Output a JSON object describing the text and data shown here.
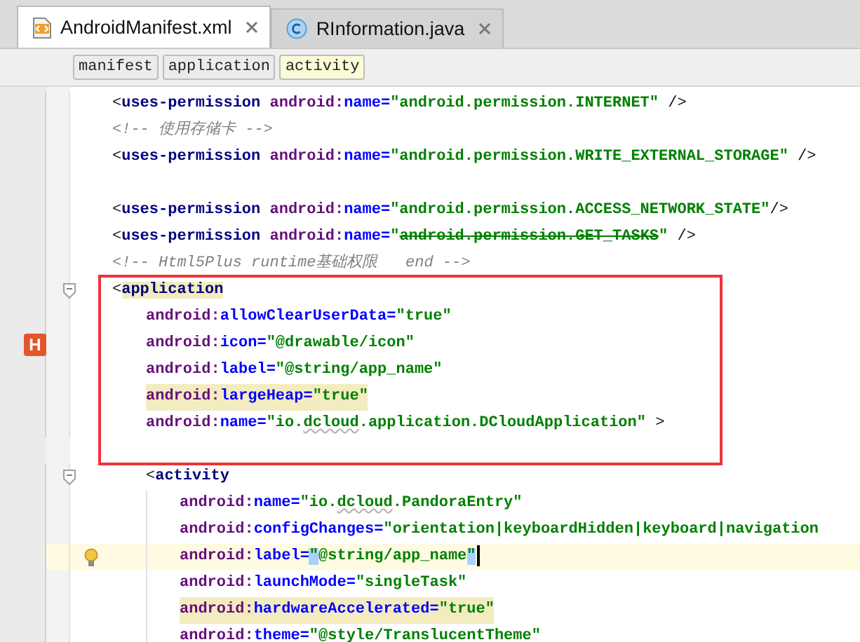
{
  "tabs": [
    {
      "label": "AndroidManifest.xml",
      "selected": true,
      "kind": "xml"
    },
    {
      "label": "RInformation.java",
      "selected": false,
      "kind": "class"
    }
  ],
  "breadcrumbs": [
    {
      "label": "manifest",
      "selected": false
    },
    {
      "label": "application",
      "selected": false
    },
    {
      "label": "activity",
      "selected": true
    }
  ],
  "lines": [
    {
      "kind": "code",
      "tokens": [
        {
          "kind": "punct",
          "text": "<"
        },
        {
          "kind": "tag",
          "text": "uses-permission"
        },
        {
          "kind": "ns",
          "text": " android:"
        },
        {
          "kind": "attr",
          "text": "name="
        },
        {
          "kind": "value",
          "text": "\"android.permission.INTERNET\""
        },
        {
          "kind": "punct",
          "text": " />"
        }
      ]
    },
    {
      "kind": "code",
      "tokens": [
        {
          "kind": "comment",
          "text": "<!-- 使用存储卡 -->"
        }
      ]
    },
    {
      "kind": "code",
      "tokens": [
        {
          "kind": "punct",
          "text": "<"
        },
        {
          "kind": "tag",
          "text": "uses-permission"
        },
        {
          "kind": "ns",
          "text": " android:"
        },
        {
          "kind": "attr",
          "text": "name="
        },
        {
          "kind": "value",
          "text": "\"android.permission.WRITE_EXTERNAL_STORAGE\""
        },
        {
          "kind": "punct",
          "text": " />"
        }
      ]
    },
    {
      "kind": "blank"
    },
    {
      "kind": "code",
      "tokens": [
        {
          "kind": "punct",
          "text": "<"
        },
        {
          "kind": "tag",
          "text": "uses-permission"
        },
        {
          "kind": "ns",
          "text": " android:"
        },
        {
          "kind": "attr",
          "text": "name="
        },
        {
          "kind": "value",
          "text": "\"android.permission.ACCESS_NETWORK_STATE\""
        },
        {
          "kind": "punct",
          "text": "/>"
        }
      ]
    },
    {
      "kind": "code",
      "tokens": [
        {
          "kind": "punct",
          "text": "<"
        },
        {
          "kind": "tag",
          "text": "uses-permission"
        },
        {
          "kind": "ns",
          "text": " android:"
        },
        {
          "kind": "attr",
          "text": "name="
        },
        {
          "kind": "value",
          "text": "\""
        },
        {
          "kind": "struck",
          "text": "android.permission.GET_TASKS"
        },
        {
          "kind": "value",
          "text": "\""
        },
        {
          "kind": "punct",
          "text": " />"
        }
      ]
    },
    {
      "kind": "code",
      "tokens": [
        {
          "kind": "comment",
          "text": "<!-- Html5Plus runtime基础权限   end -->"
        }
      ]
    },
    {
      "kind": "code",
      "gutter": {
        "kind": "fold"
      },
      "framed": true,
      "tokens": [
        {
          "kind": "punct",
          "text": "<"
        },
        {
          "kind": "tag-matched",
          "text": "application"
        }
      ],
      "attributes": [
        {
          "kind": "code",
          "tokens": [
            {
              "kind": "ns",
              "text": "android:"
            },
            {
              "kind": "attr",
              "text": "allowClearUserData="
            },
            {
              "kind": "value",
              "text": "\"true\""
            }
          ]
        },
        {
          "kind": "code",
          "gutter": {
            "kind": "bookmark",
            "label": "H"
          },
          "tokens": [
            {
              "kind": "ns",
              "text": "android:"
            },
            {
              "kind": "attr",
              "text": "icon="
            },
            {
              "kind": "value",
              "text": "\"@drawable/icon\""
            }
          ]
        },
        {
          "kind": "code",
          "tokens": [
            {
              "kind": "ns",
              "text": "android:"
            },
            {
              "kind": "attr",
              "text": "label="
            },
            {
              "kind": "value",
              "text": "\"@string/app_name\""
            }
          ]
        },
        {
          "kind": "matched",
          "tokens": [
            {
              "kind": "ns",
              "text": "android:"
            },
            {
              "kind": "attr",
              "text": "largeHeap="
            },
            {
              "kind": "value",
              "text": "\"true\""
            }
          ]
        },
        {
          "kind": "code",
          "tokens": [
            {
              "kind": "ns",
              "text": "android:"
            },
            {
              "kind": "attr",
              "text": "name="
            },
            {
              "kind": "value",
              "text": "\"io."
            },
            {
              "kind": "typo",
              "text": "dcloud"
            },
            {
              "kind": "value",
              "text": ".application.DCloudApplication\""
            },
            {
              "kind": "punct",
              "text": " >"
            }
          ]
        }
      ],
      "children": [
        {
          "kind": "code",
          "gutter": {
            "kind": "fold"
          },
          "tokens": [
            {
              "kind": "punct",
              "text": "<"
            },
            {
              "kind": "tag",
              "text": "activity"
            }
          ],
          "attributes": [
            {
              "kind": "code",
              "tokens": [
                {
                  "kind": "ns",
                  "text": "android:"
                },
                {
                  "kind": "attr",
                  "text": "name="
                },
                {
                  "kind": "value",
                  "text": "\"io."
                },
                {
                  "kind": "typo",
                  "text": "dcloud"
                },
                {
                  "kind": "value",
                  "text": ".PandoraEntry\""
                }
              ]
            },
            {
              "kind": "code",
              "tokens": [
                {
                  "kind": "ns",
                  "text": "android:"
                },
                {
                  "kind": "attr",
                  "text": "configChanges="
                },
                {
                  "kind": "value",
                  "text": "\"orientation|keyboardHidden|keyboard|navigation"
                }
              ]
            },
            {
              "kind": "current",
              "gutter": {
                "kind": "bulb"
              },
              "tokens": [
                {
                  "kind": "ns",
                  "text": "android:"
                },
                {
                  "kind": "attr",
                  "text": "label="
                },
                {
                  "kind": "selected",
                  "text": "\""
                },
                {
                  "kind": "value",
                  "text": "@string/app_name"
                },
                {
                  "kind": "selected",
                  "text": "\""
                }
              ]
            },
            {
              "kind": "code",
              "tokens": [
                {
                  "kind": "ns",
                  "text": "android:"
                },
                {
                  "kind": "attr",
                  "text": "launchMode="
                },
                {
                  "kind": "value",
                  "text": "\"singleTask\""
                }
              ]
            },
            {
              "kind": "matched",
              "tokens": [
                {
                  "kind": "ns",
                  "text": "android:"
                },
                {
                  "kind": "attr",
                  "text": "hardwareAccelerated="
                },
                {
                  "kind": "value",
                  "text": "\"true\""
                }
              ]
            },
            {
              "kind": "code",
              "tokens": [
                {
                  "kind": "ns",
                  "text": "android:"
                },
                {
                  "kind": "attr",
                  "text": "theme="
                },
                {
                  "kind": "value",
                  "text": "\"@style/TranslucentTheme\""
                }
              ]
            }
          ]
        }
      ]
    }
  ]
}
